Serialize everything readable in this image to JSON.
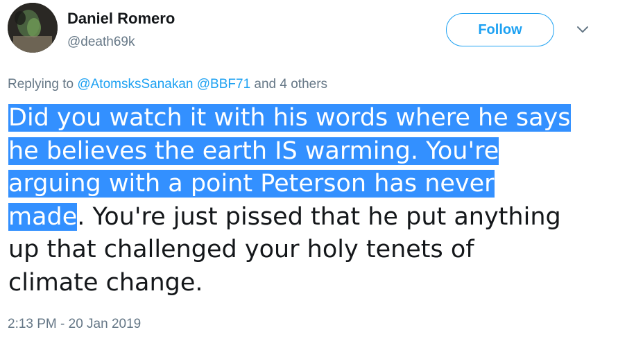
{
  "user": {
    "display_name": "Daniel Romero",
    "handle": "@death69k"
  },
  "follow_button": {
    "label": "Follow"
  },
  "reply_context": {
    "prefix": "Replying to ",
    "mention_1": "@AtomsksSanakan",
    "mention_2": "@BBF71",
    "suffix": " and 4 others"
  },
  "tweet": {
    "lines": [
      {
        "selected": "Did you watch it with his words where he says",
        "unselected": ""
      },
      {
        "selected": "he believes the earth IS warming. You're",
        "unselected": ""
      },
      {
        "selected": "arguing with a point Peterson has never",
        "unselected": ""
      },
      {
        "selected": "made",
        "unselected": ". You're just pissed that he put anything"
      },
      {
        "selected": "",
        "unselected": "up that challenged your holy tenets of"
      },
      {
        "selected": "",
        "unselected": "climate change."
      }
    ]
  },
  "timestamp": "2:13 PM - 20 Jan 2019",
  "colors": {
    "accent": "#1da1f2",
    "selection": "#3390ff",
    "secondary_text": "#657786",
    "primary_text": "#14171a"
  },
  "icons": {
    "chevron": "chevron-down-icon",
    "avatar": "avatar"
  }
}
